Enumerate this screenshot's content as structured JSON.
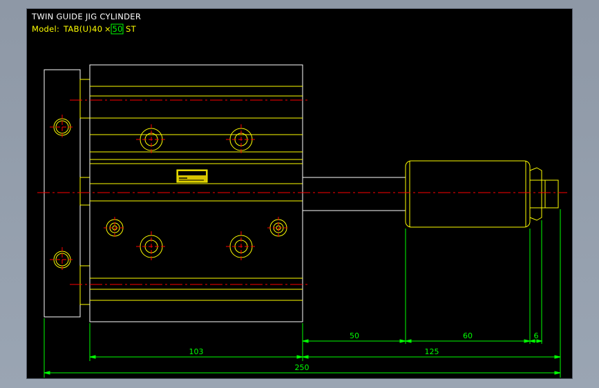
{
  "drawing": {
    "title": "TWIN GUIDE JIG CYLINDER",
    "model_label": "Model:",
    "model_prefix": "TAB(U)40",
    "model_times": "×",
    "model_stroke": "50",
    "model_suffix": "ST"
  },
  "dimensions": {
    "rod_extension": "50",
    "joint_length": "60",
    "nut_length": "6",
    "body_length": "103",
    "rod_total": "125",
    "overall": "250"
  },
  "colors": {
    "background": "#000000",
    "outline": "#ffff00",
    "edge": "#ffffff",
    "centerline": "#ff0000",
    "dimension": "#00ff00"
  }
}
